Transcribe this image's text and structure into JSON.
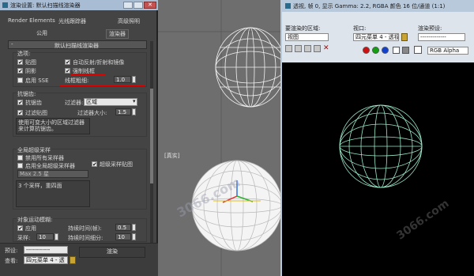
{
  "viewport": {
    "bg": "#6f6f6f",
    "label_bottom": "[真实]",
    "watermark_main": "3066.com",
    "watermark_second": "3066.com"
  },
  "render_setup": {
    "title": "渲染设置: 默认扫描线渲染器",
    "tabs_row1": [
      "Render Elements",
      "光线跟踪器",
      "高级照明"
    ],
    "tabs_row2": [
      "公用",
      "渲染器"
    ],
    "rollout_title": "默认扫描线渲染器",
    "options": {
      "header": "选项:",
      "maps": "贴图",
      "auto_reflect": "自动反射/折射和镜像",
      "shadows": "阴影",
      "force_wire": "强制线框",
      "enable_sse": "启用 SSE",
      "wire_thickness_label": "线框粗细:",
      "wire_thickness_value": "1.0"
    },
    "antialiasing": {
      "header": "抗锯齿:",
      "antialias": "抗锯齿",
      "filter_label": "过滤器:",
      "filter_value": "区域",
      "filter_maps": "过滤贴图",
      "filter_size_label": "过滤器大小:",
      "filter_size_value": "1.5",
      "description": "使用可变大小的区域过滤器来计算抗锯齿。"
    },
    "global_supersampling": {
      "header": "全局超级采样",
      "disable_all": "禁用所有采样器",
      "enable_global": "启用全局超级采样器",
      "supersample_maps": "超级采样贴图",
      "sampler_value": "Max 2.5 星",
      "sampler_desc": "3 个采样，重四面"
    },
    "motion_blur": {
      "header": "对象运动模糊:",
      "apply": "应用",
      "duration_label": "持续时间(帧):",
      "duration_value": "0.5",
      "samples_label": "采样:",
      "samples_value": "10",
      "subdiv_label": "持续时间细分:",
      "subdiv_value": "10"
    },
    "bottom": {
      "preset_label": "预设:",
      "preset_value": "------------",
      "view_label": "查看:",
      "view_value": "四元菜单 4 - 透",
      "render_button": "渲染"
    }
  },
  "frame_window": {
    "title": "透视, 帧 0, 显示 Gamma: 2.2, RGBA 颜色 16 位/通道 (1:1)",
    "area_label": "要渲染的区域:",
    "area_value": "视图",
    "viewport_label": "视口:",
    "viewport_value": "四元菜单 4 - 透视",
    "preset_label": "渲染预设:",
    "preset_value": "-------------",
    "channel_value": "RGB Alpha",
    "watermark": "3066.com",
    "dot_colors": [
      "#d01010",
      "#10a010",
      "#1040d0"
    ]
  }
}
